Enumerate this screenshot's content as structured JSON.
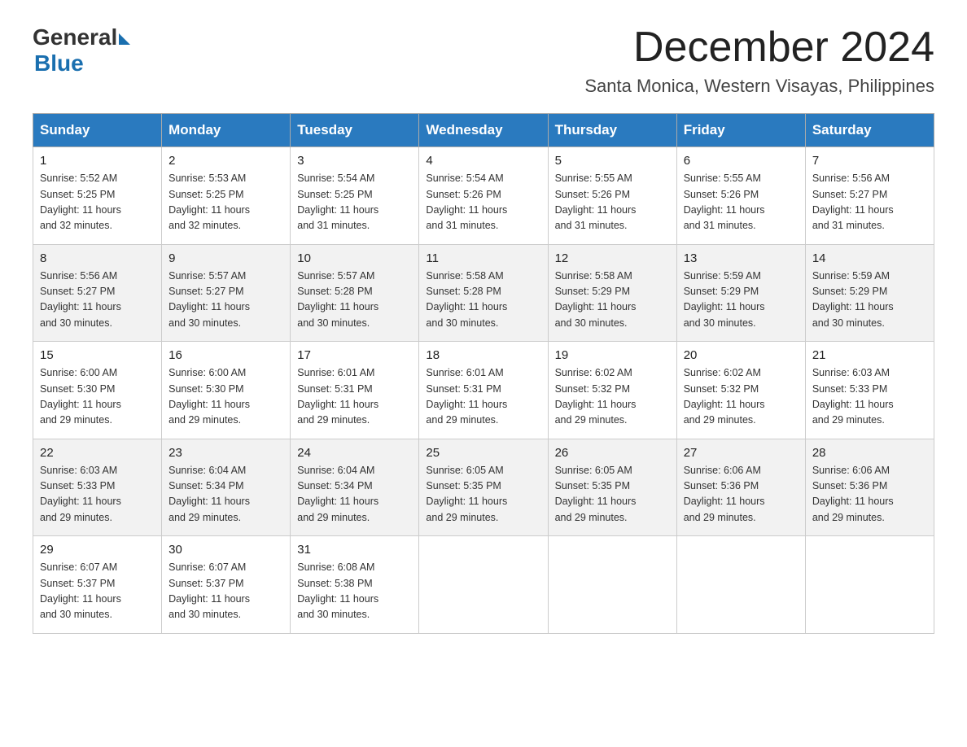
{
  "logo": {
    "general": "General",
    "blue": "Blue"
  },
  "title": "December 2024",
  "location": "Santa Monica, Western Visayas, Philippines",
  "days_of_week": [
    "Sunday",
    "Monday",
    "Tuesday",
    "Wednesday",
    "Thursday",
    "Friday",
    "Saturday"
  ],
  "weeks": [
    [
      {
        "day": "1",
        "sunrise": "5:52 AM",
        "sunset": "5:25 PM",
        "daylight": "11 hours and 32 minutes."
      },
      {
        "day": "2",
        "sunrise": "5:53 AM",
        "sunset": "5:25 PM",
        "daylight": "11 hours and 32 minutes."
      },
      {
        "day": "3",
        "sunrise": "5:54 AM",
        "sunset": "5:25 PM",
        "daylight": "11 hours and 31 minutes."
      },
      {
        "day": "4",
        "sunrise": "5:54 AM",
        "sunset": "5:26 PM",
        "daylight": "11 hours and 31 minutes."
      },
      {
        "day": "5",
        "sunrise": "5:55 AM",
        "sunset": "5:26 PM",
        "daylight": "11 hours and 31 minutes."
      },
      {
        "day": "6",
        "sunrise": "5:55 AM",
        "sunset": "5:26 PM",
        "daylight": "11 hours and 31 minutes."
      },
      {
        "day": "7",
        "sunrise": "5:56 AM",
        "sunset": "5:27 PM",
        "daylight": "11 hours and 31 minutes."
      }
    ],
    [
      {
        "day": "8",
        "sunrise": "5:56 AM",
        "sunset": "5:27 PM",
        "daylight": "11 hours and 30 minutes."
      },
      {
        "day": "9",
        "sunrise": "5:57 AM",
        "sunset": "5:27 PM",
        "daylight": "11 hours and 30 minutes."
      },
      {
        "day": "10",
        "sunrise": "5:57 AM",
        "sunset": "5:28 PM",
        "daylight": "11 hours and 30 minutes."
      },
      {
        "day": "11",
        "sunrise": "5:58 AM",
        "sunset": "5:28 PM",
        "daylight": "11 hours and 30 minutes."
      },
      {
        "day": "12",
        "sunrise": "5:58 AM",
        "sunset": "5:29 PM",
        "daylight": "11 hours and 30 minutes."
      },
      {
        "day": "13",
        "sunrise": "5:59 AM",
        "sunset": "5:29 PM",
        "daylight": "11 hours and 30 minutes."
      },
      {
        "day": "14",
        "sunrise": "5:59 AM",
        "sunset": "5:29 PM",
        "daylight": "11 hours and 30 minutes."
      }
    ],
    [
      {
        "day": "15",
        "sunrise": "6:00 AM",
        "sunset": "5:30 PM",
        "daylight": "11 hours and 29 minutes."
      },
      {
        "day": "16",
        "sunrise": "6:00 AM",
        "sunset": "5:30 PM",
        "daylight": "11 hours and 29 minutes."
      },
      {
        "day": "17",
        "sunrise": "6:01 AM",
        "sunset": "5:31 PM",
        "daylight": "11 hours and 29 minutes."
      },
      {
        "day": "18",
        "sunrise": "6:01 AM",
        "sunset": "5:31 PM",
        "daylight": "11 hours and 29 minutes."
      },
      {
        "day": "19",
        "sunrise": "6:02 AM",
        "sunset": "5:32 PM",
        "daylight": "11 hours and 29 minutes."
      },
      {
        "day": "20",
        "sunrise": "6:02 AM",
        "sunset": "5:32 PM",
        "daylight": "11 hours and 29 minutes."
      },
      {
        "day": "21",
        "sunrise": "6:03 AM",
        "sunset": "5:33 PM",
        "daylight": "11 hours and 29 minutes."
      }
    ],
    [
      {
        "day": "22",
        "sunrise": "6:03 AM",
        "sunset": "5:33 PM",
        "daylight": "11 hours and 29 minutes."
      },
      {
        "day": "23",
        "sunrise": "6:04 AM",
        "sunset": "5:34 PM",
        "daylight": "11 hours and 29 minutes."
      },
      {
        "day": "24",
        "sunrise": "6:04 AM",
        "sunset": "5:34 PM",
        "daylight": "11 hours and 29 minutes."
      },
      {
        "day": "25",
        "sunrise": "6:05 AM",
        "sunset": "5:35 PM",
        "daylight": "11 hours and 29 minutes."
      },
      {
        "day": "26",
        "sunrise": "6:05 AM",
        "sunset": "5:35 PM",
        "daylight": "11 hours and 29 minutes."
      },
      {
        "day": "27",
        "sunrise": "6:06 AM",
        "sunset": "5:36 PM",
        "daylight": "11 hours and 29 minutes."
      },
      {
        "day": "28",
        "sunrise": "6:06 AM",
        "sunset": "5:36 PM",
        "daylight": "11 hours and 29 minutes."
      }
    ],
    [
      {
        "day": "29",
        "sunrise": "6:07 AM",
        "sunset": "5:37 PM",
        "daylight": "11 hours and 30 minutes."
      },
      {
        "day": "30",
        "sunrise": "6:07 AM",
        "sunset": "5:37 PM",
        "daylight": "11 hours and 30 minutes."
      },
      {
        "day": "31",
        "sunrise": "6:08 AM",
        "sunset": "5:38 PM",
        "daylight": "11 hours and 30 minutes."
      },
      null,
      null,
      null,
      null
    ]
  ],
  "labels": {
    "sunrise": "Sunrise:",
    "sunset": "Sunset:",
    "daylight": "Daylight:"
  }
}
